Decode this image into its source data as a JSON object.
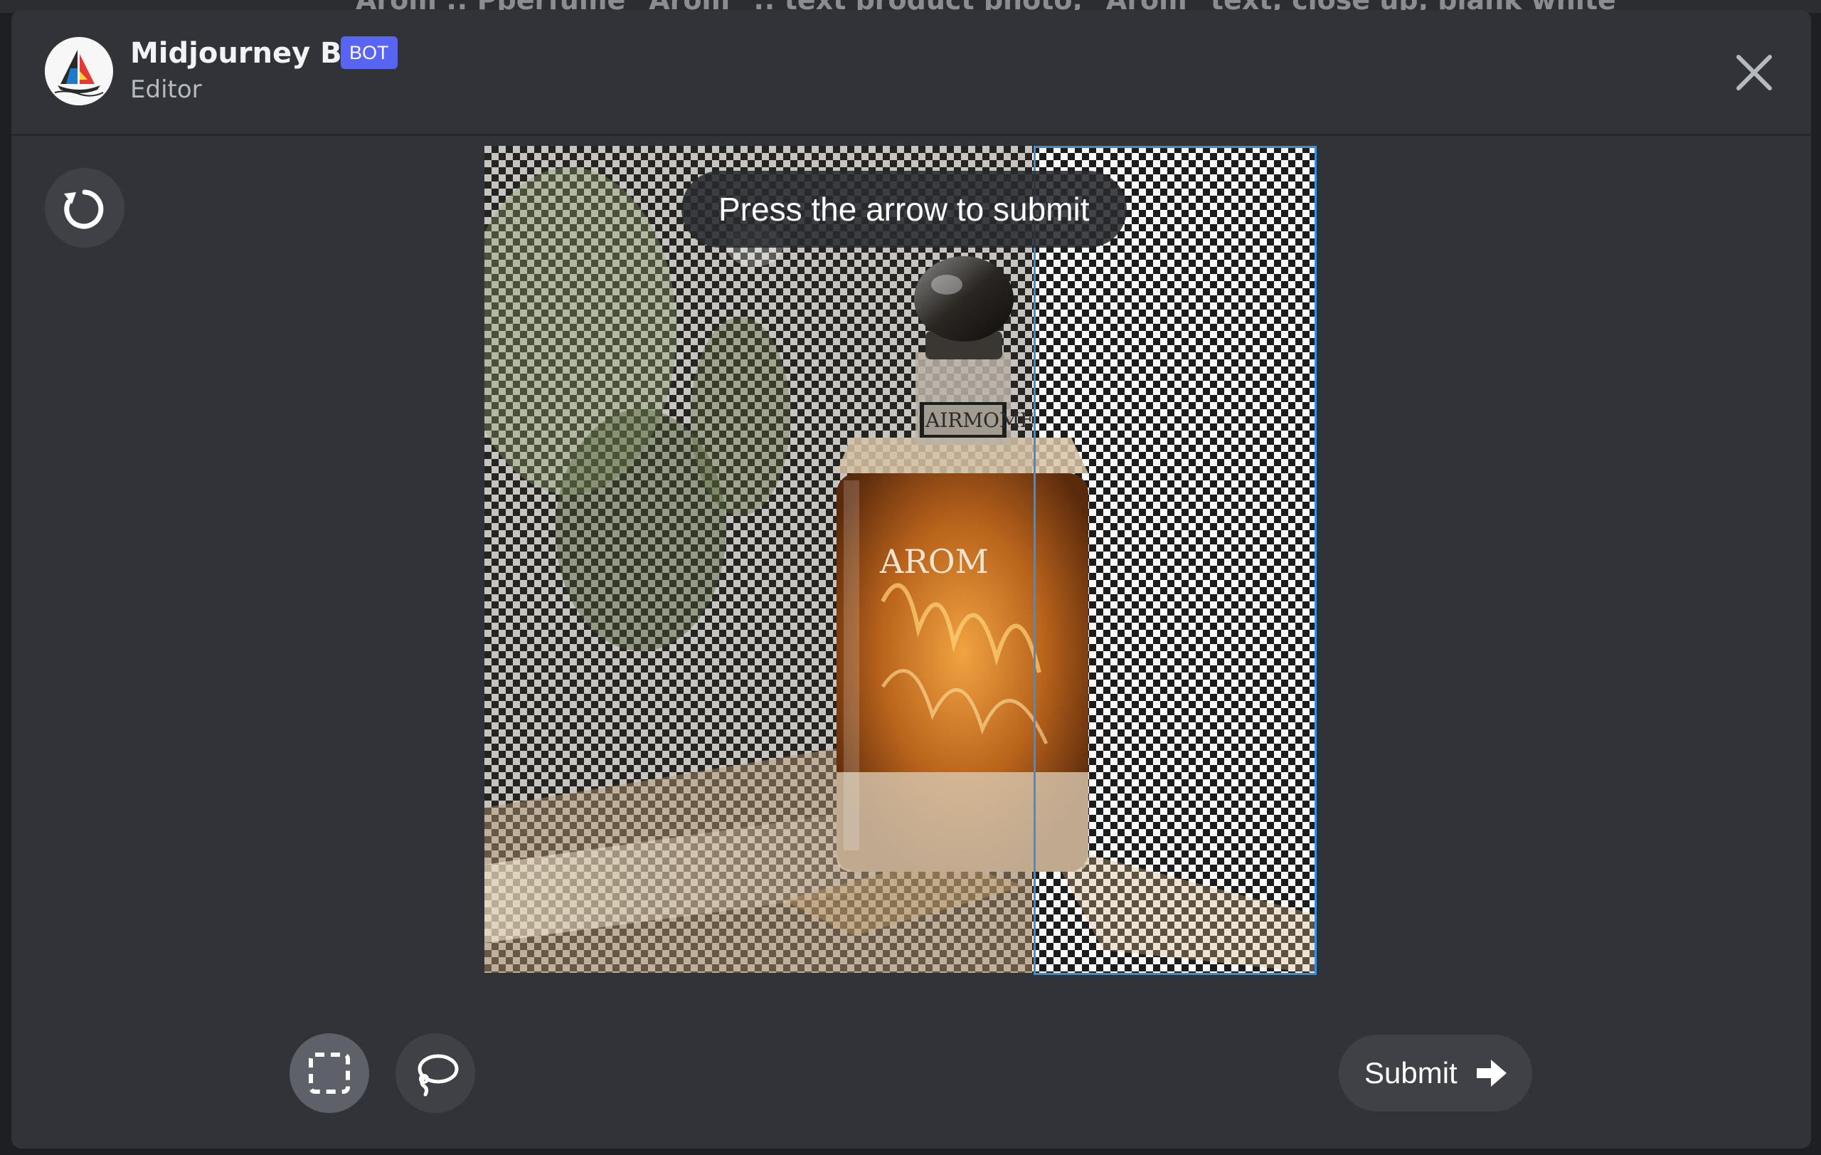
{
  "background": {
    "behind_text": "Arom :: Pperfume \"Arom\" :: text product photo, \"Arom\" text, close up, blank white"
  },
  "header": {
    "bot_name": "Midjourney Bot",
    "badge": "BOT",
    "subtitle": "Editor",
    "avatar_icon": "midjourney-sailboat-logo",
    "close_icon": "close-x-icon"
  },
  "toolbar": {
    "undo_icon": "undo-icon",
    "rect_select_icon": "rectangle-select-icon",
    "lasso_icon": "lasso-icon",
    "submit_label": "Submit",
    "submit_icon": "arrow-right-icon"
  },
  "canvas": {
    "tooltip": "Press the arrow to submit",
    "bottle_neck_label": "AIRMOME",
    "bottle_label": "AROM"
  },
  "colors": {
    "modal_bg": "#313338",
    "badge_bg": "#5865f2",
    "selection_border": "#3f8fd6",
    "button_bg": "#3f4147"
  }
}
